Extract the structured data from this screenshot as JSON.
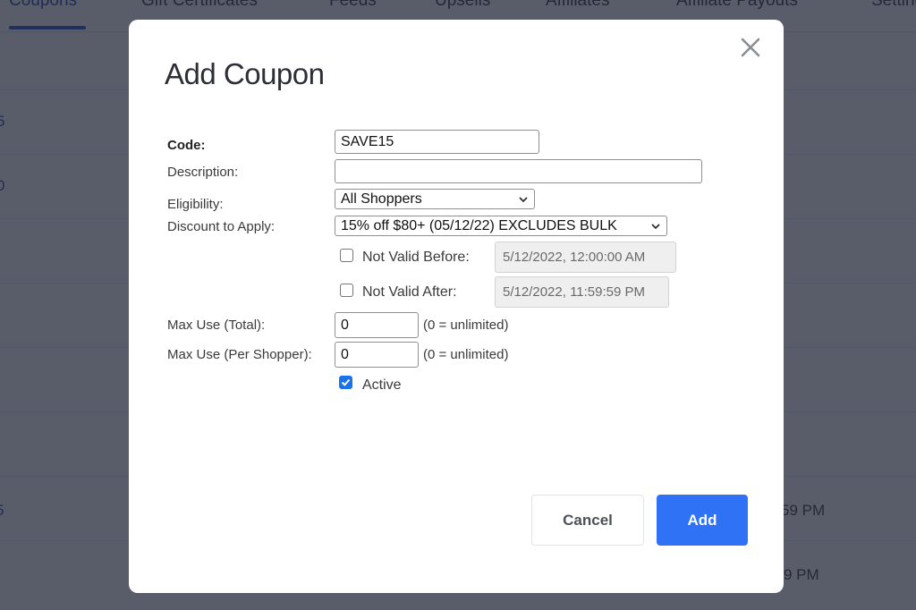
{
  "background": {
    "tabs": [
      {
        "label": "Coupons",
        "active": true
      },
      {
        "label": "Gift Certificates",
        "active": false
      },
      {
        "label": "Feeds",
        "active": false
      },
      {
        "label": "Upsells",
        "active": false
      },
      {
        "label": "Affiliates",
        "active": false
      },
      {
        "label": "Affiliate Payouts",
        "active": false
      },
      {
        "label": "Settings",
        "active": false
      }
    ],
    "row_fragments_left": [
      "5",
      "0",
      "5"
    ],
    "row_fragments_right": [
      "59 PM",
      "9 PM"
    ]
  },
  "modal": {
    "title": "Add Coupon",
    "close_icon": "close-icon",
    "fields": {
      "code": {
        "label": "Code:",
        "value": "SAVE15"
      },
      "description": {
        "label": "Description:",
        "value": ""
      },
      "eligibility": {
        "label": "Eligibility:",
        "selected": "All Shoppers"
      },
      "discount": {
        "label": "Discount to Apply:",
        "selected": "15% off $80+ (05/12/22) EXCLUDES BULK"
      },
      "not_valid_before": {
        "label": "Not Valid Before:",
        "checked": false,
        "value": "5/12/2022, 12:00:00 AM"
      },
      "not_valid_after": {
        "label": "Not Valid After:",
        "checked": false,
        "value": "5/12/2022, 11:59:59 PM"
      },
      "max_use_total": {
        "label": "Max Use (Total):",
        "value": "0",
        "hint": "(0 = unlimited)"
      },
      "max_use_per_shopper": {
        "label": "Max Use (Per Shopper):",
        "value": "0",
        "hint": "(0 = unlimited)"
      },
      "active": {
        "label": "Active",
        "checked": true
      }
    },
    "buttons": {
      "cancel": "Cancel",
      "add": "Add"
    }
  },
  "colors": {
    "primary": "#2f72f5",
    "overlay": "#5a5f6e",
    "checkbox_checked": "#1a73e8",
    "tab_active": "#1f49c9"
  }
}
